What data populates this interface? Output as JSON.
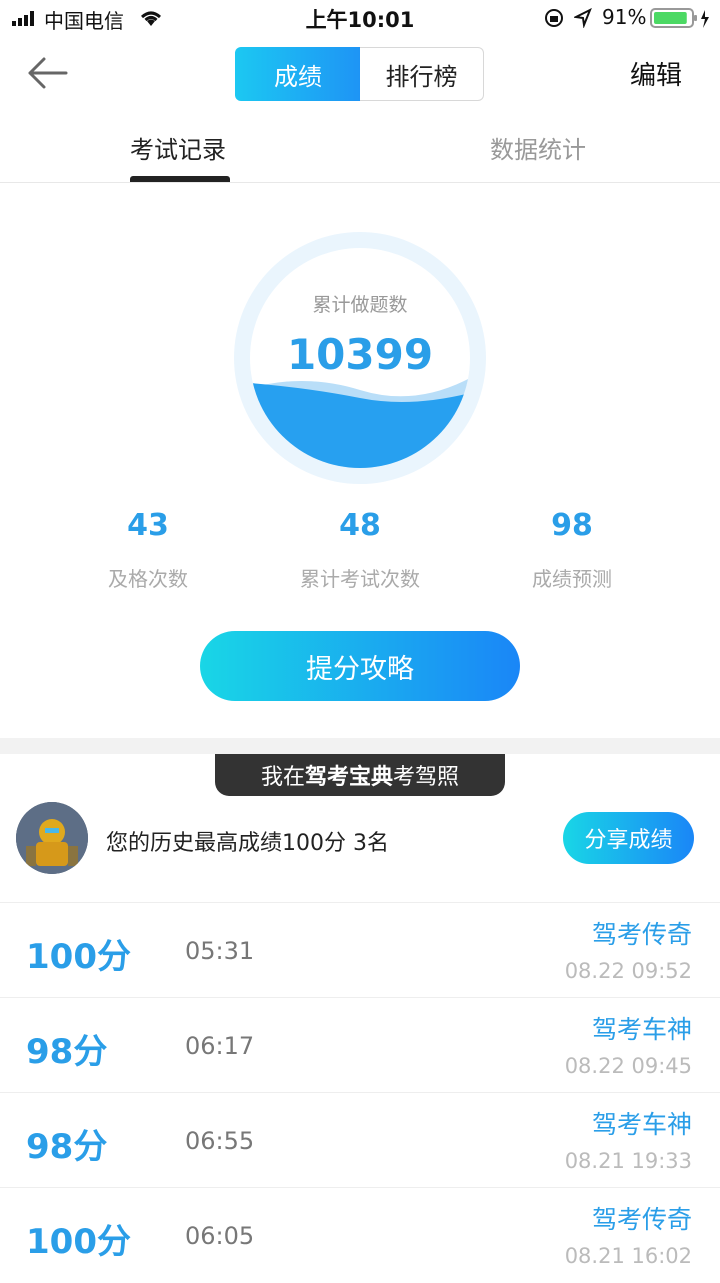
{
  "status_bar": {
    "carrier": "中国电信",
    "time": "上午10:01",
    "battery": "91%",
    "battery_level": 0.91
  },
  "nav": {
    "segments": [
      "成绩",
      "排行榜"
    ],
    "edit": "编辑"
  },
  "tabs": [
    "考试记录",
    "数据统计"
  ],
  "summary": {
    "label": "累计做题数",
    "value": "10399"
  },
  "stats": [
    {
      "value": "43",
      "label": "及格次数"
    },
    {
      "value": "48",
      "label": "累计考试次数"
    },
    {
      "value": "98",
      "label": "成绩预测"
    }
  ],
  "tips_button": "提分攻略",
  "banner": {
    "pre": "我在",
    "bold": "驾考宝典",
    "post": "考驾照"
  },
  "best": {
    "text": "您的历史最高成绩100分 3名",
    "share": "分享成绩"
  },
  "records": [
    {
      "score": "100分",
      "duration": "05:31",
      "title": "驾考传奇",
      "date": "08.22 09:52"
    },
    {
      "score": "98分",
      "duration": "06:17",
      "title": "驾考车神",
      "date": "08.22 09:45"
    },
    {
      "score": "98分",
      "duration": "06:55",
      "title": "驾考车神",
      "date": "08.21 19:33"
    },
    {
      "score": "100分",
      "duration": "06:05",
      "title": "驾考传奇",
      "date": "08.21 16:02"
    }
  ],
  "colors": {
    "accent": "#2a9ee8",
    "gradient_start": "#19d6e6",
    "gradient_end": "#1a86f7"
  }
}
